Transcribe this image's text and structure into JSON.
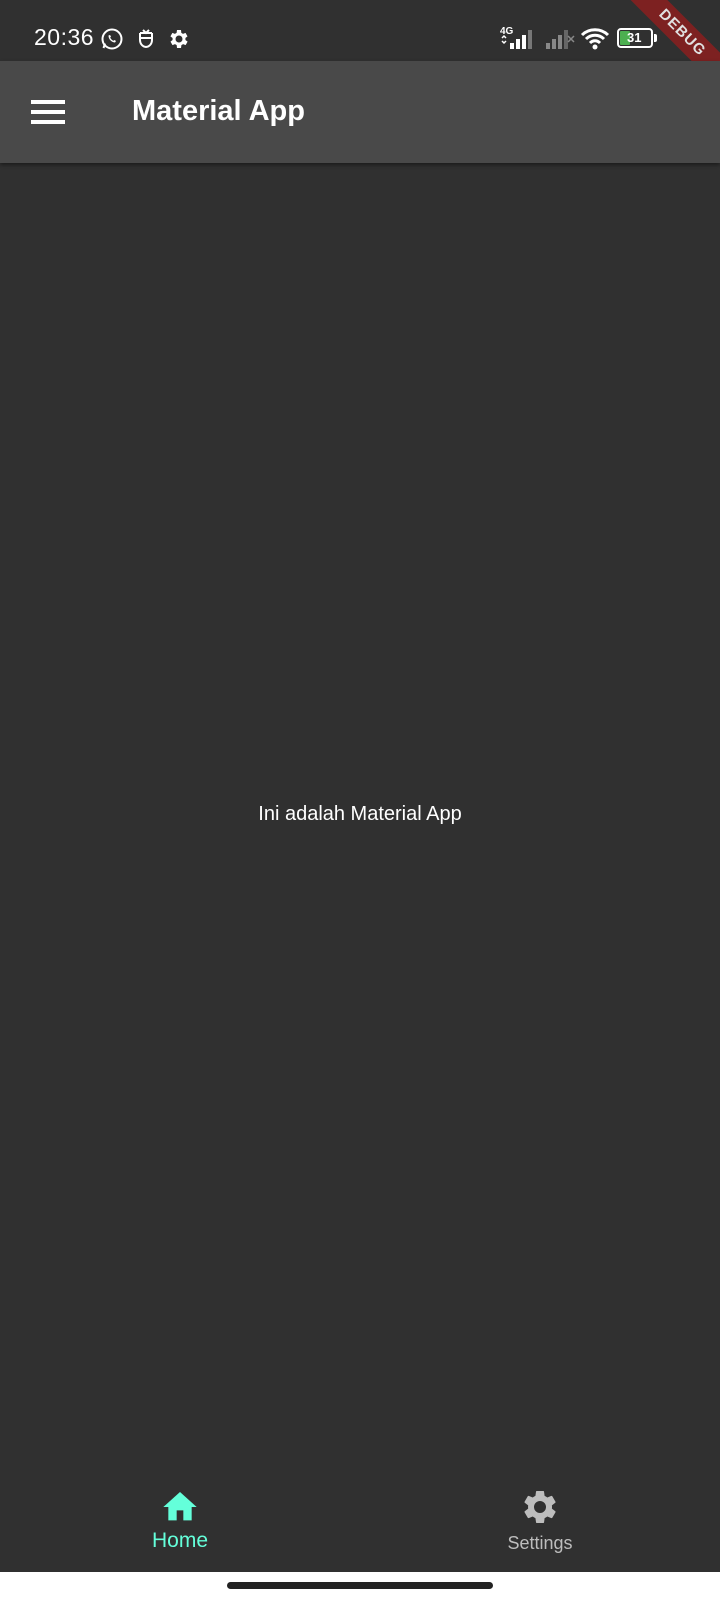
{
  "status_bar": {
    "time": "20:36",
    "network_label": "4G",
    "battery_level": "31",
    "icons": [
      "whatsapp-icon",
      "notification-icon",
      "settings-gear-icon",
      "signal-icon",
      "signal-2-icon",
      "wifi-icon",
      "battery-icon"
    ]
  },
  "debug_banner": "DEBUG",
  "app_bar": {
    "title": "Material App",
    "menu_icon": "hamburger-menu-icon"
  },
  "main": {
    "text": "Ini adalah Material App"
  },
  "bottom_nav": {
    "items": [
      {
        "label": "Home",
        "icon": "home-icon",
        "active": true
      },
      {
        "label": "Settings",
        "icon": "gear-icon",
        "active": false
      }
    ]
  },
  "colors": {
    "background": "#303030",
    "app_bar": "#494949",
    "accent": "#64ffda",
    "inactive": "#bdbdbd",
    "debug": "#8b1f1f"
  }
}
